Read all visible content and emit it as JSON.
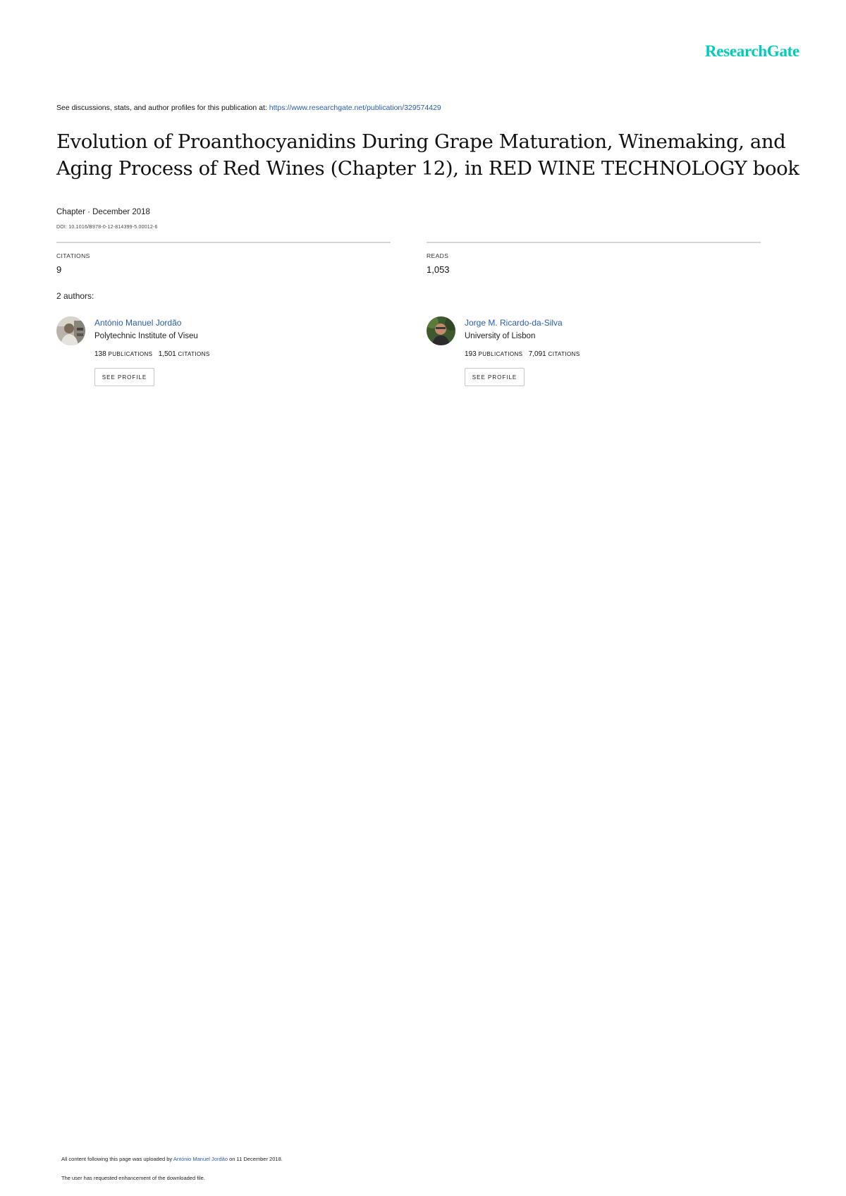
{
  "brand": {
    "logo_text": "ResearchGate",
    "color": "#00ccbb"
  },
  "header": {
    "see_prefix": "See discussions, stats, and author profiles for this publication at: ",
    "see_link": "https://www.researchgate.net/publication/329574429"
  },
  "publication": {
    "title": "Evolution of Proanthocyanidins During Grape Maturation, Winemaking, and Aging Process of Red Wines (Chapter 12), in RED WINE TECHNOLOGY book",
    "meta": "Chapter · December 2018",
    "doi": "DOI: 10.1016/B978-0-12-814399-5.00012-6"
  },
  "stats": {
    "citations_label": "CITATIONS",
    "citations_value": "9",
    "reads_label": "READS",
    "reads_value": "1,053"
  },
  "authors_label": "2 authors:",
  "authors": [
    {
      "name": "António Manuel Jordão",
      "institution": "Polytechnic Institute of Viseu",
      "publications": "138",
      "publications_label": "PUBLICATIONS",
      "citations": "1,501",
      "citations_label": "CITATIONS",
      "button_label": "SEE PROFILE"
    },
    {
      "name": "Jorge M. Ricardo-da-Silva",
      "institution": "University of Lisbon",
      "publications": "193",
      "publications_label": "PUBLICATIONS",
      "citations": "7,091",
      "citations_label": "CITATIONS",
      "button_label": "SEE PROFILE"
    }
  ],
  "footer": {
    "uploaded_prefix": "All content following this page was uploaded by ",
    "uploaded_by": "António Manuel Jordão",
    "uploaded_suffix": " on 11 December 2018.",
    "enhancement_note": "The user has requested enhancement of the downloaded file."
  }
}
